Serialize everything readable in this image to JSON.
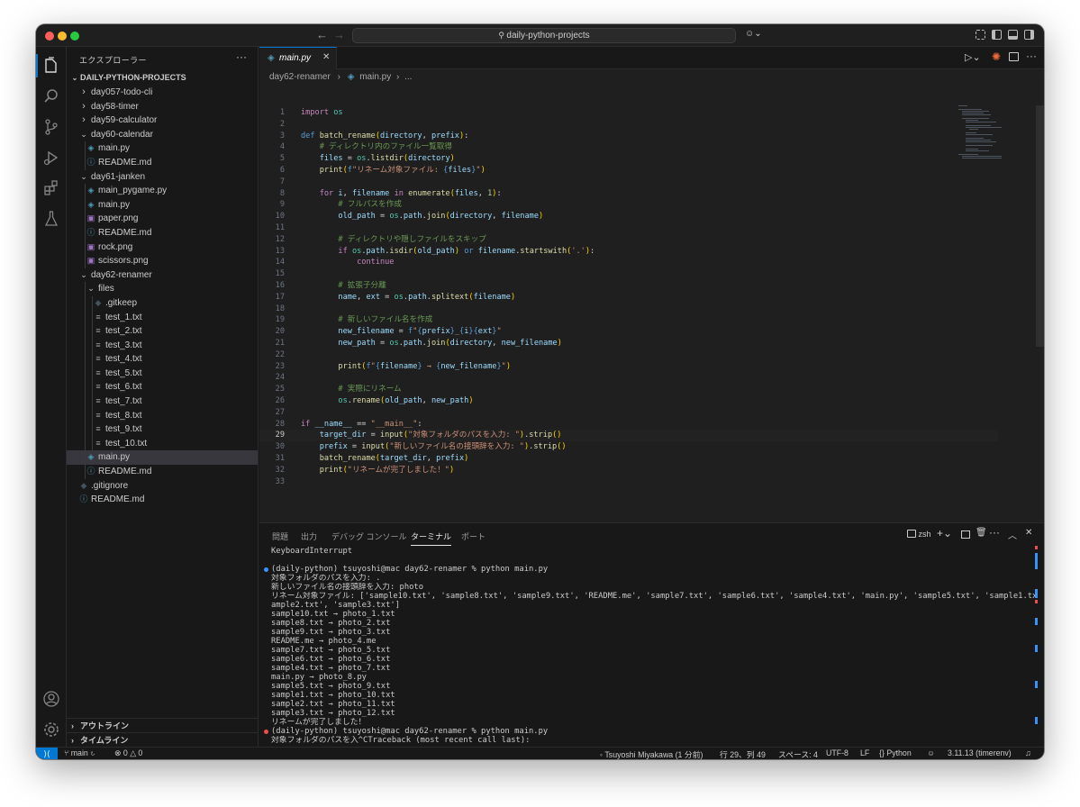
{
  "titlebar": {
    "search": "daily-python-projects"
  },
  "sidebar": {
    "title": "エクスプローラー",
    "root": "DAILY-PYTHON-PROJECTS",
    "items": [
      {
        "label": "day057-todo-cli",
        "indent": 1,
        "type": "folder",
        "open": false
      },
      {
        "label": "day58-timer",
        "indent": 1,
        "type": "folder",
        "open": false
      },
      {
        "label": "day59-calculator",
        "indent": 1,
        "type": "folder",
        "open": false
      },
      {
        "label": "day60-calendar",
        "indent": 1,
        "type": "folder",
        "open": true
      },
      {
        "label": "main.py",
        "indent": 2,
        "type": "py"
      },
      {
        "label": "README.md",
        "indent": 2,
        "type": "md"
      },
      {
        "label": "day61-janken",
        "indent": 1,
        "type": "folder",
        "open": true
      },
      {
        "label": "main_pygame.py",
        "indent": 2,
        "type": "py"
      },
      {
        "label": "main.py",
        "indent": 2,
        "type": "py"
      },
      {
        "label": "paper.png",
        "indent": 2,
        "type": "png"
      },
      {
        "label": "README.md",
        "indent": 2,
        "type": "md"
      },
      {
        "label": "rock.png",
        "indent": 2,
        "type": "png"
      },
      {
        "label": "scissors.png",
        "indent": 2,
        "type": "png"
      },
      {
        "label": "day62-renamer",
        "indent": 1,
        "type": "folder",
        "open": true
      },
      {
        "label": "files",
        "indent": 2,
        "type": "folder",
        "open": true
      },
      {
        "label": ".gitkeep",
        "indent": 3,
        "type": "git"
      },
      {
        "label": "test_1.txt",
        "indent": 3,
        "type": "txt"
      },
      {
        "label": "test_2.txt",
        "indent": 3,
        "type": "txt"
      },
      {
        "label": "test_3.txt",
        "indent": 3,
        "type": "txt"
      },
      {
        "label": "test_4.txt",
        "indent": 3,
        "type": "txt"
      },
      {
        "label": "test_5.txt",
        "indent": 3,
        "type": "txt"
      },
      {
        "label": "test_6.txt",
        "indent": 3,
        "type": "txt"
      },
      {
        "label": "test_7.txt",
        "indent": 3,
        "type": "txt"
      },
      {
        "label": "test_8.txt",
        "indent": 3,
        "type": "txt"
      },
      {
        "label": "test_9.txt",
        "indent": 3,
        "type": "txt"
      },
      {
        "label": "test_10.txt",
        "indent": 3,
        "type": "txt"
      },
      {
        "label": "main.py",
        "indent": 2,
        "type": "py",
        "selected": true
      },
      {
        "label": "README.md",
        "indent": 2,
        "type": "md"
      },
      {
        "label": ".gitignore",
        "indent": 1,
        "type": "git"
      },
      {
        "label": "README.md",
        "indent": 1,
        "type": "md"
      }
    ],
    "outline": "アウトライン",
    "timeline": "タイムライン"
  },
  "editor": {
    "tab": "main.py",
    "breadcrumb_folder": "day62-renamer",
    "breadcrumb_file": "main.py",
    "breadcrumb_more": "...",
    "current_line": 29,
    "lines": [
      [
        [
          "k",
          "import"
        ],
        [
          "p",
          " "
        ],
        [
          "t",
          "os"
        ]
      ],
      [],
      [
        [
          "kb",
          "def"
        ],
        [
          "p",
          " "
        ],
        [
          "f",
          "batch_rename"
        ],
        [
          "b",
          "("
        ],
        [
          "v",
          "directory"
        ],
        [
          "p",
          ", "
        ],
        [
          "v",
          "prefix"
        ],
        [
          "b",
          ")"
        ],
        [
          "p",
          ":"
        ]
      ],
      [
        [
          "p",
          "    "
        ],
        [
          "c",
          "# ディレクトリ内のファイル一覧取得"
        ]
      ],
      [
        [
          "p",
          "    "
        ],
        [
          "v",
          "files"
        ],
        [
          "p",
          " = "
        ],
        [
          "t",
          "os"
        ],
        [
          "p",
          "."
        ],
        [
          "f",
          "listdir"
        ],
        [
          "b",
          "("
        ],
        [
          "v",
          "directory"
        ],
        [
          "b",
          ")"
        ]
      ],
      [
        [
          "p",
          "    "
        ],
        [
          "f",
          "print"
        ],
        [
          "b",
          "("
        ],
        [
          "kb",
          "f"
        ],
        [
          "s",
          "\"リネーム対象ファイル: "
        ],
        [
          "kb",
          "{"
        ],
        [
          "v",
          "files"
        ],
        [
          "kb",
          "}"
        ],
        [
          "s",
          "\""
        ],
        [
          "b",
          ")"
        ]
      ],
      [],
      [
        [
          "p",
          "    "
        ],
        [
          "k",
          "for"
        ],
        [
          "p",
          " "
        ],
        [
          "v",
          "i"
        ],
        [
          "p",
          ", "
        ],
        [
          "v",
          "filename"
        ],
        [
          "p",
          " "
        ],
        [
          "k",
          "in"
        ],
        [
          "p",
          " "
        ],
        [
          "f",
          "enumerate"
        ],
        [
          "b",
          "("
        ],
        [
          "v",
          "files"
        ],
        [
          "p",
          ", "
        ],
        [
          "n",
          "1"
        ],
        [
          "b",
          ")"
        ],
        [
          "p",
          ":"
        ]
      ],
      [
        [
          "p",
          "        "
        ],
        [
          "c",
          "# フルパスを作成"
        ]
      ],
      [
        [
          "p",
          "        "
        ],
        [
          "v",
          "old_path"
        ],
        [
          "p",
          " = "
        ],
        [
          "t",
          "os"
        ],
        [
          "p",
          "."
        ],
        [
          "v",
          "path"
        ],
        [
          "p",
          "."
        ],
        [
          "f",
          "join"
        ],
        [
          "b",
          "("
        ],
        [
          "v",
          "directory"
        ],
        [
          "p",
          ", "
        ],
        [
          "v",
          "filename"
        ],
        [
          "b",
          ")"
        ]
      ],
      [],
      [
        [
          "p",
          "        "
        ],
        [
          "c",
          "# ディレクトリや隠しファイルをスキップ"
        ]
      ],
      [
        [
          "p",
          "        "
        ],
        [
          "k",
          "if"
        ],
        [
          "p",
          " "
        ],
        [
          "t",
          "os"
        ],
        [
          "p",
          "."
        ],
        [
          "v",
          "path"
        ],
        [
          "p",
          "."
        ],
        [
          "f",
          "isdir"
        ],
        [
          "b",
          "("
        ],
        [
          "v",
          "old_path"
        ],
        [
          "b",
          ")"
        ],
        [
          "p",
          " "
        ],
        [
          "kb",
          "or"
        ],
        [
          "p",
          " "
        ],
        [
          "v",
          "filename"
        ],
        [
          "p",
          "."
        ],
        [
          "f",
          "startswith"
        ],
        [
          "b",
          "("
        ],
        [
          "s",
          "'.'"
        ],
        [
          "b",
          ")"
        ],
        [
          "p",
          ":"
        ]
      ],
      [
        [
          "p",
          "            "
        ],
        [
          "k",
          "continue"
        ]
      ],
      [],
      [
        [
          "p",
          "        "
        ],
        [
          "c",
          "# 拡張子分離"
        ]
      ],
      [
        [
          "p",
          "        "
        ],
        [
          "v",
          "name"
        ],
        [
          "p",
          ", "
        ],
        [
          "v",
          "ext"
        ],
        [
          "p",
          " = "
        ],
        [
          "t",
          "os"
        ],
        [
          "p",
          "."
        ],
        [
          "v",
          "path"
        ],
        [
          "p",
          "."
        ],
        [
          "f",
          "splitext"
        ],
        [
          "b",
          "("
        ],
        [
          "v",
          "filename"
        ],
        [
          "b",
          ")"
        ]
      ],
      [],
      [
        [
          "p",
          "        "
        ],
        [
          "c",
          "# 新しいファイル名を作成"
        ]
      ],
      [
        [
          "p",
          "        "
        ],
        [
          "v",
          "new_filename"
        ],
        [
          "p",
          " = "
        ],
        [
          "kb",
          "f"
        ],
        [
          "s",
          "\""
        ],
        [
          "kb",
          "{"
        ],
        [
          "v",
          "prefix"
        ],
        [
          "kb",
          "}"
        ],
        [
          "s",
          "_"
        ],
        [
          "kb",
          "{"
        ],
        [
          "v",
          "i"
        ],
        [
          "kb",
          "}"
        ],
        [
          "kb",
          "{"
        ],
        [
          "v",
          "ext"
        ],
        [
          "kb",
          "}"
        ],
        [
          "s",
          "\""
        ]
      ],
      [
        [
          "p",
          "        "
        ],
        [
          "v",
          "new_path"
        ],
        [
          "p",
          " = "
        ],
        [
          "t",
          "os"
        ],
        [
          "p",
          "."
        ],
        [
          "v",
          "path"
        ],
        [
          "p",
          "."
        ],
        [
          "f",
          "join"
        ],
        [
          "b",
          "("
        ],
        [
          "v",
          "directory"
        ],
        [
          "p",
          ", "
        ],
        [
          "v",
          "new_filename"
        ],
        [
          "b",
          ")"
        ]
      ],
      [],
      [
        [
          "p",
          "        "
        ],
        [
          "f",
          "print"
        ],
        [
          "b",
          "("
        ],
        [
          "kb",
          "f"
        ],
        [
          "s",
          "\""
        ],
        [
          "kb",
          "{"
        ],
        [
          "v",
          "filename"
        ],
        [
          "kb",
          "}"
        ],
        [
          "s",
          " → "
        ],
        [
          "kb",
          "{"
        ],
        [
          "v",
          "new_filename"
        ],
        [
          "kb",
          "}"
        ],
        [
          "s",
          "\""
        ],
        [
          "b",
          ")"
        ]
      ],
      [],
      [
        [
          "p",
          "        "
        ],
        [
          "c",
          "# 実際にリネーム"
        ]
      ],
      [
        [
          "p",
          "        "
        ],
        [
          "t",
          "os"
        ],
        [
          "p",
          "."
        ],
        [
          "f",
          "rename"
        ],
        [
          "b",
          "("
        ],
        [
          "v",
          "old_path"
        ],
        [
          "p",
          ", "
        ],
        [
          "v",
          "new_path"
        ],
        [
          "b",
          ")"
        ]
      ],
      [],
      [
        [
          "k",
          "if"
        ],
        [
          "p",
          " "
        ],
        [
          "v",
          "__name__"
        ],
        [
          "p",
          " == "
        ],
        [
          "s",
          "\"__main__\""
        ],
        [
          "p",
          ":"
        ]
      ],
      [
        [
          "p",
          "    "
        ],
        [
          "v",
          "target_dir"
        ],
        [
          "p",
          " = "
        ],
        [
          "f",
          "input"
        ],
        [
          "b",
          "("
        ],
        [
          "s",
          "\"対象フォルダのパスを入力: \""
        ],
        [
          "b",
          ")"
        ],
        [
          "p",
          "."
        ],
        [
          "f",
          "strip"
        ],
        [
          "b",
          "()"
        ]
      ],
      [
        [
          "p",
          "    "
        ],
        [
          "v",
          "prefix"
        ],
        [
          "p",
          " = "
        ],
        [
          "f",
          "input"
        ],
        [
          "b",
          "("
        ],
        [
          "s",
          "\"新しいファイル名の接頭辞を入力: \""
        ],
        [
          "b",
          ")"
        ],
        [
          "p",
          "."
        ],
        [
          "f",
          "strip"
        ],
        [
          "b",
          "()"
        ]
      ],
      [
        [
          "p",
          "    "
        ],
        [
          "f",
          "batch_rename"
        ],
        [
          "b",
          "("
        ],
        [
          "v",
          "target_dir"
        ],
        [
          "p",
          ", "
        ],
        [
          "v",
          "prefix"
        ],
        [
          "b",
          ")"
        ]
      ],
      [
        [
          "p",
          "    "
        ],
        [
          "f",
          "print"
        ],
        [
          "b",
          "("
        ],
        [
          "s",
          "\"リネームが完了しました！\""
        ],
        [
          "b",
          ")"
        ]
      ],
      []
    ]
  },
  "panel": {
    "tabs": [
      "問題",
      "出力",
      "デバッグ コンソール",
      "ターミナル",
      "ポート"
    ],
    "active_tab": 3,
    "shell": "zsh",
    "terminal_lines": [
      "KeyboardInterrupt",
      "",
      "(daily-python) tsuyoshi@mac day62-renamer % python main.py",
      "対象フォルダのパスを入力: .",
      "新しいファイル名の接頭辞を入力: photo",
      "リネーム対象ファイル: ['sample10.txt', 'sample8.txt', 'sample9.txt', 'README.me', 'sample7.txt', 'sample6.txt', 'sample4.txt', 'main.py', 'sample5.txt', 'sample1.txt', 's",
      "ample2.txt', 'sample3.txt']",
      "sample10.txt → photo_1.txt",
      "sample8.txt → photo_2.txt",
      "sample9.txt → photo_3.txt",
      "README.me → photo_4.me",
      "sample7.txt → photo_5.txt",
      "sample6.txt → photo_6.txt",
      "sample4.txt → photo_7.txt",
      "main.py → photo_8.py",
      "sample5.txt → photo_9.txt",
      "sample1.txt → photo_10.txt",
      "sample2.txt → photo_11.txt",
      "sample3.txt → photo_12.txt",
      "リネームが完了しました！",
      "(daily-python) tsuyoshi@mac day62-renamer % python main.py",
      "対象フォルダのパスを入^CTraceback (most recent call last):"
    ]
  },
  "status": {
    "branch": "main",
    "problems": "0",
    "warnings": "0",
    "blame": "Tsuyoshi Miyakawa (1 分前)",
    "position": "行 29、列 49",
    "spaces": "スペース: 4",
    "encoding": "UTF-8",
    "eol": "LF",
    "language": "Python",
    "interpreter": "3.11.13 (timerenv)"
  },
  "colors": {
    "accent": "#0078d4",
    "background": "#1f1f1f",
    "sidebar": "#181818"
  }
}
